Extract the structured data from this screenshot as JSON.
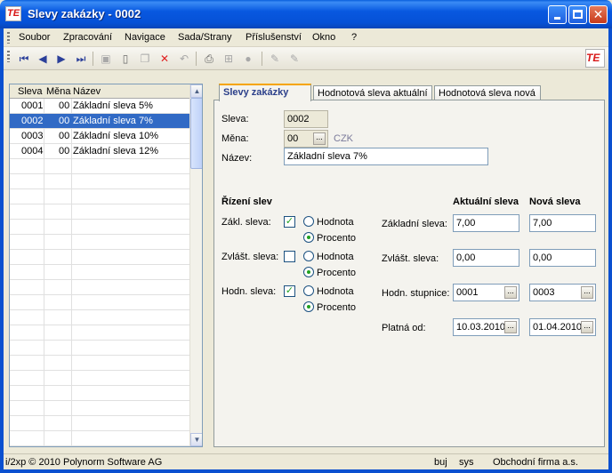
{
  "window": {
    "title": "Slevy zakázky - 0002",
    "logo": "TE"
  },
  "menu": [
    "Soubor",
    "Zpracování",
    "Navigace",
    "Sada/Strany",
    "Příslušenství",
    "Okno",
    "?"
  ],
  "toolbar_icons": [
    "first-record-icon",
    "prev-record-icon",
    "next-record-icon",
    "last-record-icon",
    "save-icon",
    "new-icon",
    "copy-icon",
    "delete-icon",
    "undo-icon",
    "print-icon",
    "tree-icon",
    "stop-icon",
    "edit-icon",
    "edit-alt-icon"
  ],
  "grid": {
    "headers": [
      "Sleva",
      "Měna",
      "Název"
    ],
    "rows": [
      {
        "sleva": "0001",
        "mena": "00",
        "nazev": "Základní sleva 5%"
      },
      {
        "sleva": "0002",
        "mena": "00",
        "nazev": "Základní sleva 7%"
      },
      {
        "sleva": "0003",
        "mena": "00",
        "nazev": "Základní sleva 10%"
      },
      {
        "sleva": "0004",
        "mena": "00",
        "nazev": "Základní sleva 12%"
      }
    ],
    "selected_index": 1
  },
  "tabs": [
    "Slevy zakázky",
    "Hodnotová sleva aktuální",
    "Hodnotová sleva nová"
  ],
  "form": {
    "sleva_label": "Sleva:",
    "sleva_value": "0002",
    "mena_label": "Měna:",
    "mena_value": "00",
    "mena_name": "CZK",
    "nazev_label": "Název:",
    "nazev_value": "Základní sleva 7%",
    "rizeni_header": "Řízení slev",
    "aktualni_header": "Aktuální sleva",
    "nova_header": "Nová sleva",
    "zakl_label": "Zákl. sleva:",
    "zvlast_label": "Zvlášt. sleva:",
    "hodn_label": "Hodn. sleva:",
    "hodnota_label": "Hodnota",
    "procento_label": "Procento",
    "zakladni_sleva_label": "Základní sleva:",
    "zakladni_aktualni": "7,00",
    "zakladni_nova": "7,00",
    "zvlast_sleva_label": "Zvlášt. sleva:",
    "zvlast_aktualni": "0,00",
    "zvlast_nova": "0,00",
    "stupnice_label": "Hodn. stupnice:",
    "stupnice_aktualni": "0001",
    "stupnice_nova": "0003",
    "platna_label": "Platná od:",
    "platna_aktualni": "10.03.2010",
    "platna_nova": "01.04.2010",
    "ellipsis": "..."
  },
  "status": {
    "left": "i/2xp © 2010 Polynorm Software AG",
    "buj": "buj",
    "sys": "sys",
    "firma": "Obchodní firma a.s."
  }
}
